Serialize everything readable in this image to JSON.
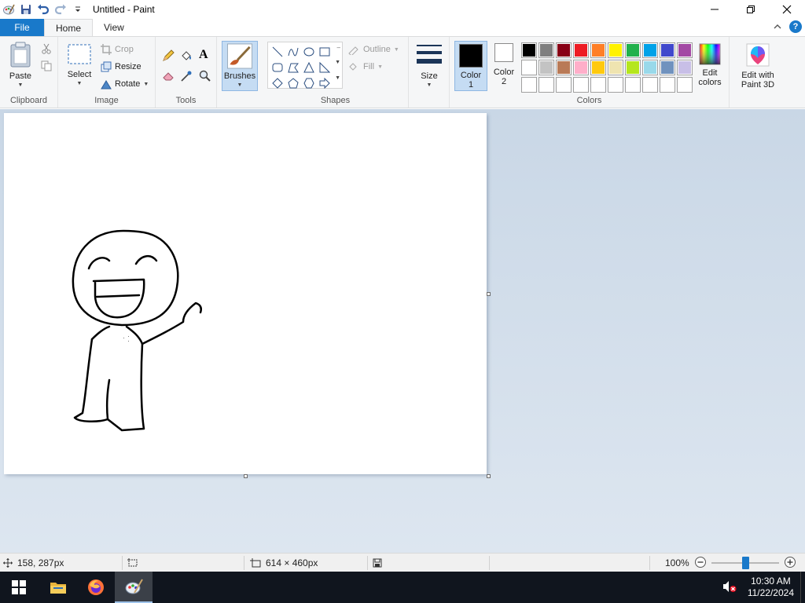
{
  "window": {
    "title": "Untitled - Paint"
  },
  "tabs": {
    "file": "File",
    "home": "Home",
    "view": "View"
  },
  "ribbon": {
    "clipboard": {
      "label": "Clipboard",
      "paste": "Paste"
    },
    "image": {
      "label": "Image",
      "select": "Select",
      "crop": "Crop",
      "resize": "Resize",
      "rotate": "Rotate"
    },
    "tools": {
      "label": "Tools"
    },
    "brushes": {
      "label": "Brushes"
    },
    "shapes": {
      "label": "Shapes",
      "outline": "Outline",
      "fill": "Fill"
    },
    "size": {
      "label": "Size"
    },
    "colors": {
      "label": "Colors",
      "color1": "Color 1",
      "color1_line1": "Color",
      "color1_line2": "1",
      "color2_line1": "Color",
      "color2_line2": "2",
      "color1_value": "#000000",
      "color2_value": "#ffffff",
      "edit_colors_line1": "Edit",
      "edit_colors_line2": "colors",
      "paint3d_line1": "Edit with",
      "paint3d_line2": "Paint 3D",
      "palette": [
        "#000000",
        "#7f7f7f",
        "#880015",
        "#ed1c24",
        "#ff7f27",
        "#fff200",
        "#22b14c",
        "#00a2e8",
        "#3f48cc",
        "#a349a4",
        "#ffffff",
        "#c3c3c3",
        "#b97a57",
        "#ffaec9",
        "#ffc90e",
        "#efe4b0",
        "#b5e61d",
        "#99d9ea",
        "#7092be",
        "#c8bfe7",
        "#ffffff",
        "#ffffff",
        "#ffffff",
        "#ffffff",
        "#ffffff",
        "#ffffff",
        "#ffffff",
        "#ffffff",
        "#ffffff",
        "#ffffff"
      ]
    }
  },
  "statusbar": {
    "cursor_pos": "158, 287px",
    "canvas_size": "614 × 460px",
    "zoom": "100%",
    "zoom_level": 0.5
  },
  "taskbar": {
    "time": "10:30 AM",
    "date": "11/22/2024"
  }
}
